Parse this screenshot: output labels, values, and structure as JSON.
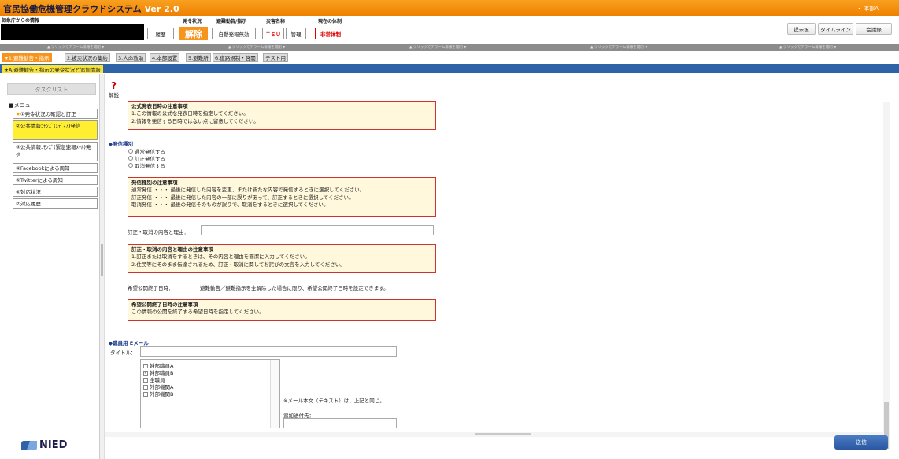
{
  "header": {
    "app_title": "官民協働危機管理クラウドシステム",
    "version": "Ver 2.0",
    "user": "・ 本部A",
    "jma_label": "気象庁からの情報",
    "status_label": "発令状況",
    "status_value": "解除",
    "history_button": "履歴",
    "evac_label": "避難勧告/指示",
    "evac_auto_button": "自動発報無効",
    "disaster_label": "災害名称",
    "disaster_value": "ＴＳＵ",
    "manage_button": "管理",
    "system_label": "現在の体制",
    "system_value": "非常体制",
    "top_buttons": [
      "提示板",
      "タイムライン",
      "会議録"
    ]
  },
  "strip": {
    "items": [
      "▲ クリックでアラーム情報を開閉 ▼",
      "▲ クリックでアラーム情報を開閉 ▼",
      "▲ クリックでアラーム情報を開閉 ▼",
      "▲ クリックでアラーム情報を開閉 ▼",
      "▲ クリックでアラーム情報を開閉 ▼"
    ]
  },
  "tabs": [
    {
      "label": "★1.避難勧告・指示",
      "active": true
    },
    {
      "label": "2.被災状況の集約",
      "active": false
    },
    {
      "label": "3.人命救助",
      "active": false
    },
    {
      "label": "4.本部設置",
      "active": false
    },
    {
      "label": "5.避難所",
      "active": false
    },
    {
      "label": "6.道路規制・啓開",
      "active": false
    },
    {
      "label": "テスト用",
      "active": false
    }
  ],
  "subtab": "★A.避難勧告・指示の発令状況と追加情報",
  "sidebar": {
    "tasklist": "タスクリスト",
    "menu_label": "■メニュー",
    "items": [
      {
        "star": "★",
        "label": "①発令状況の確認と訂正"
      },
      {
        "label": "②公共情報ｺﾓﾝｽﾞ(ﾒﾃﾞｨｱ)発信"
      },
      {
        "label": "③公共情報ｺﾓﾝｽﾞ(緊急速報ﾒｰﾙ)発信"
      },
      {
        "label": "④Facebookによる周知"
      },
      {
        "label": "⑤Twitterによる周知"
      },
      {
        "label": "⑥対応状況"
      },
      {
        "label": "⑦対応履歴"
      }
    ],
    "logo_text": "NIED"
  },
  "content": {
    "help_label": "解説",
    "note1": {
      "title": "公式発表日時の注意事項",
      "lines": [
        "1.この情報の公式な発表日時を指定してください。",
        "2.情報を発信する日時ではない点に留意してください。"
      ]
    },
    "send_type_title": "◆発信種別",
    "radios": [
      "通常発信する",
      "訂正発信する",
      "取消発信する"
    ],
    "note2": {
      "title": "発信種別の注意事項",
      "lines": [
        "通常発信 ・・・ 最後に発信した内容を変更、または新たな内容で発信するときに選択してください。",
        "訂正発信 ・・・ 最後に発信した内容の一部に誤りがあって、訂正するときに選択してください。",
        "取消発信 ・・・ 最後の発信そのものが誤りで、取消をするときに選択してください。"
      ]
    },
    "correction_label": "訂正・取消の内容と理由：",
    "note3": {
      "title": "訂正・取消の内容と理由の注意事項",
      "lines": [
        "1.訂正または取消をするときは、その内容と理由を簡潔に入力してください。",
        "2.住民等にそのまま伝達されるため、訂正・取消に関してお詫びの文言を入力してください。"
      ]
    },
    "end_label": "希望公開終了日時：",
    "end_note": "避難勧告／避難指示を全解除した場合に限り、希望公開終了日時を設定できます。",
    "note4": {
      "title": "希望公開終了日時の注意事項",
      "lines": [
        "この情報の公開を終了する希望日時を指定してください。"
      ]
    },
    "email_title": "◆職員用 Eメール",
    "subject_label": "タイトル：",
    "recipients": [
      {
        "label": "幹部職員A",
        "checked": false
      },
      {
        "label": "幹部職員B",
        "checked": true
      },
      {
        "label": "全職員",
        "checked": false
      },
      {
        "label": "外部機関A",
        "checked": false
      },
      {
        "label": "外部機関B",
        "checked": false
      }
    ],
    "mail_body_note": "※メール本文（テキスト）は、上記と同じ。",
    "extra_recipient_label": "追加送付先：",
    "send_button": "送信"
  }
}
